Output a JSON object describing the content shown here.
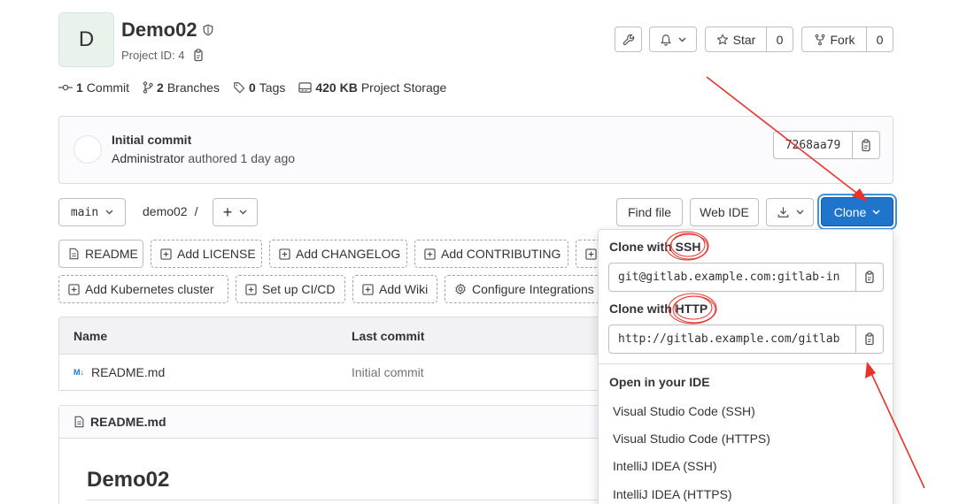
{
  "project": {
    "avatar_letter": "D",
    "name": "Demo02",
    "id_label": "Project ID: 4"
  },
  "actions": {
    "star_label": "Star",
    "star_count": "0",
    "fork_label": "Fork",
    "fork_count": "0"
  },
  "stats": {
    "commits_count": "1",
    "commits_label": "Commit",
    "branches_count": "2",
    "branches_label": "Branches",
    "tags_count": "0",
    "tags_label": "Tags",
    "storage_size": "420 KB",
    "storage_label": "Project Storage"
  },
  "last_commit": {
    "title": "Initial commit",
    "author": "Administrator",
    "meta": "authored 1 day ago",
    "sha": "7268aa79"
  },
  "toolbar": {
    "branch": "main",
    "path": "demo02",
    "path_sep": "/",
    "add_label": "+",
    "find_file": "Find file",
    "web_ide": "Web IDE",
    "clone": "Clone"
  },
  "quick_actions": {
    "readme": "README",
    "add_license": "Add LICENSE",
    "add_changelog": "Add CHANGELOG",
    "add_contributing": "Add CONTRIBUTING",
    "add_kubernetes": "Add Kubernetes cluster",
    "setup_cicd": "Set up CI/CD",
    "add_wiki": "Add Wiki",
    "configure_integrations": "Configure Integrations"
  },
  "file_table": {
    "col_name": "Name",
    "col_last_commit": "Last commit",
    "rows": [
      {
        "badge": "M↓",
        "name": "README.md",
        "commit": "Initial commit"
      }
    ]
  },
  "readme": {
    "filename": "README.md",
    "heading": "Demo02"
  },
  "clone_dropdown": {
    "ssh_label": "Clone with SSH",
    "ssh_url": "git@gitlab.example.com:gitlab-in",
    "http_label": "Clone with HTTP",
    "http_url": "http://gitlab.example.com/gitlab",
    "ide_header": "Open in your IDE",
    "ide_items": [
      "Visual Studio Code (SSH)",
      "Visual Studio Code (HTTPS)",
      "IntelliJ IDEA (SSH)",
      "IntelliJ IDEA (HTTPS)"
    ]
  },
  "colors": {
    "primary": "#1f75cb",
    "annotation": "#e8322b"
  }
}
